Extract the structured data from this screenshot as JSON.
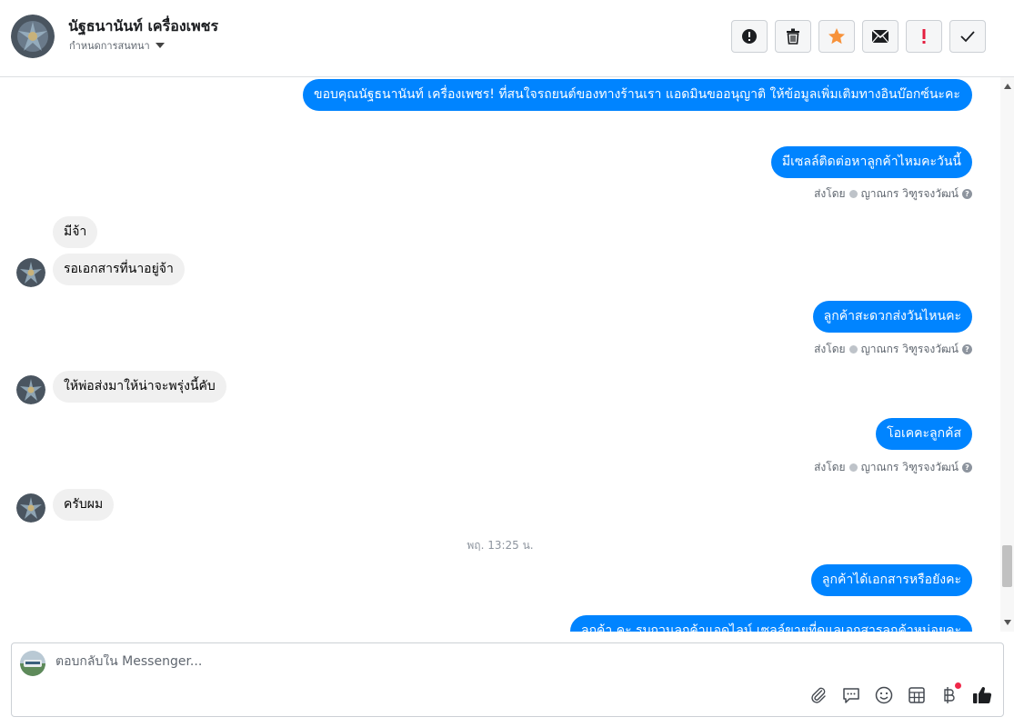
{
  "header": {
    "contact_name": "นัฐธนานันท์ เครื่องเพชร",
    "label_dropdown": "กำหนดการสนทนา",
    "actions": [
      {
        "icon": "alert-circle-icon"
      },
      {
        "icon": "trash-icon"
      },
      {
        "icon": "star-icon",
        "color": "#f7923a"
      },
      {
        "icon": "envelope-icon"
      },
      {
        "icon": "exclamation-icon",
        "color": "#e41e3f"
      },
      {
        "icon": "check-icon"
      }
    ]
  },
  "messages": [
    {
      "dir": "out",
      "text": "ขอบคุณนัฐธนานันท์ เครื่องเพชร! ที่สนใจรถยนต์ของทางร้านเรา แอดมินขออนุญาติ ให้ข้อมูลเพิ่มเติมทางอินบ๊อกซ์นะคะ"
    },
    {
      "dir": "out",
      "text": "มีเซลล์ติดต่อหาลูกค้าไหมคะวันนี้",
      "sent_by": "ส่งโดย",
      "agent": "ญาณกร วิฑูรจงวัฒน์"
    },
    {
      "dir": "in",
      "text": "มีจ้า"
    },
    {
      "dir": "in",
      "text": "รอเอกสารที่นาอยู่จ้า"
    },
    {
      "dir": "out",
      "text": "ลูกค้าสะดวกส่งวันไหนคะ",
      "sent_by": "ส่งโดย",
      "agent": "ญาณกร วิฑูรจงวัฒน์"
    },
    {
      "dir": "in",
      "text": "ให้พ่อส่งมาให้น่าจะพรุ่งนี้คับ"
    },
    {
      "dir": "out",
      "text": "โอเคคะลูกค้ส",
      "sent_by": "ส่งโดย",
      "agent": "ญาณกร วิฑูรจงวัฒน์"
    },
    {
      "dir": "in",
      "text": "ครับผม"
    },
    {
      "dir": "out",
      "text": "ลูกค้าได้เอกสารหรือยังคะ"
    },
    {
      "dir": "out",
      "text": "ลูกค้า คะ รบกวนลูกค้าแอดไลน์ เซลล์ขายที่ดูแลเอกสารลูกค้าหน่อยคะ"
    }
  ],
  "timestamp": "พฤ. 13:25 น.",
  "composer": {
    "placeholder": "ตอบกลับใน Messenger...",
    "tools": [
      "paperclip-icon",
      "chat-bubble-icon",
      "smiley-icon",
      "table-icon",
      "baht-icon",
      "thumbs-up-icon"
    ]
  },
  "colors": {
    "outgoing": "#0084ff",
    "incoming": "#f0f0f0",
    "thumb": "#1c1e21"
  }
}
